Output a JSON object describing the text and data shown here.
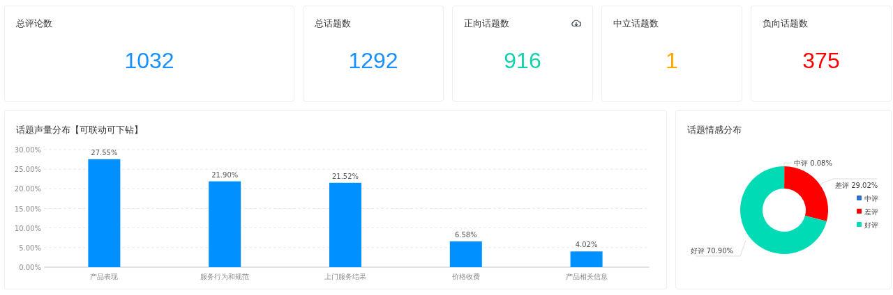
{
  "stat_cards": [
    {
      "title": "总评论数",
      "value": "1032",
      "color": "#1890ff",
      "download_button": false
    },
    {
      "title": "总话题数",
      "value": "1292",
      "color": "#1890ff",
      "download_button": false
    },
    {
      "title": "正向话题数",
      "value": "916",
      "color": "#13d1ac",
      "download_button": true
    },
    {
      "title": "中立话题数",
      "value": "1",
      "color": "#ffa800",
      "download_button": false
    },
    {
      "title": "负向话题数",
      "value": "375",
      "color": "#ff0000",
      "download_button": false
    }
  ],
  "volume_panel": {
    "title": "话题声量分布【可联动可下钻】",
    "chart_data": {
      "type": "bar",
      "categories": [
        "产品表现",
        "服务行为和规范",
        "上门服务结果",
        "价格收费",
        "产品相关信息"
      ],
      "series": [
        {
          "color": "#0090ff",
          "values": [
            27.55,
            21.9,
            21.52,
            6.58,
            4.02
          ]
        }
      ],
      "ylim": [
        0,
        30
      ],
      "grid": true,
      "yticks": [
        {
          "value": 0,
          "label": "0.00%"
        },
        {
          "value": 5,
          "label": "5.00%"
        },
        {
          "value": 10,
          "label": "10.00%"
        },
        {
          "value": 15,
          "label": "15.00%"
        },
        {
          "value": 20,
          "label": "20.00%"
        },
        {
          "value": 25,
          "label": "25.00%"
        },
        {
          "value": 30,
          "label": "30.00%"
        }
      ],
      "value_labels": [
        "27.55%",
        "21.90%",
        "21.52%",
        "6.58%",
        "4.02%"
      ]
    }
  },
  "sentiment_panel": {
    "title": "话题情感分布",
    "chart_data": {
      "type": "donut",
      "categories": [
        "中评",
        "差评",
        "好评"
      ],
      "values": [
        0.08,
        29.02,
        70.9
      ],
      "colors": [
        "#2e6fcf",
        "#ff0000",
        "#00dbb5"
      ],
      "legend": "right",
      "value_labels": [
        "中评 0.08%",
        "差评 29.02%",
        "好评 70.90%"
      ]
    }
  }
}
